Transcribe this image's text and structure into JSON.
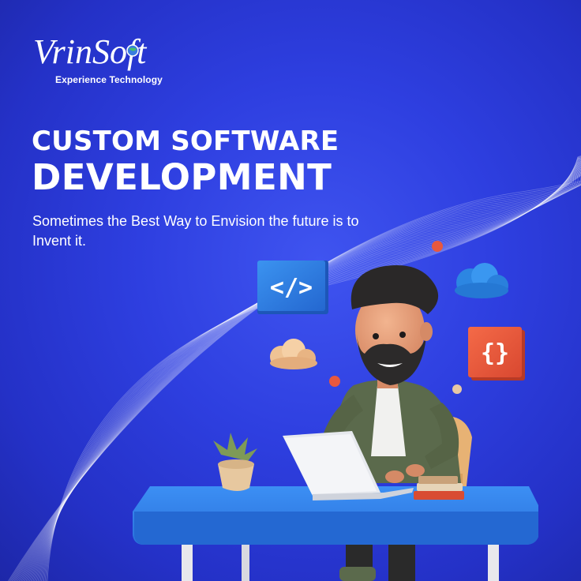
{
  "brand": {
    "name": "VrinSoft",
    "tagline": "Experience Technology"
  },
  "headline": {
    "line1": "CUSTOM SOFTWARE",
    "line2": "DEVELOPMENT"
  },
  "subtitle": "Sometimes the Best Way to Envision the future is to Invent it.",
  "icons": {
    "code_tag": "</>",
    "curly_braces": "{}"
  },
  "colors": {
    "background": "#2e3fe0",
    "desk": "#2f80ee",
    "code_tile": "#2f7fe6",
    "braces_tile": "#ee5a3c",
    "cloud_blue": "#2e8fe8",
    "cloud_peach": "#f0c59a",
    "jacket": "#5d6a4f"
  }
}
